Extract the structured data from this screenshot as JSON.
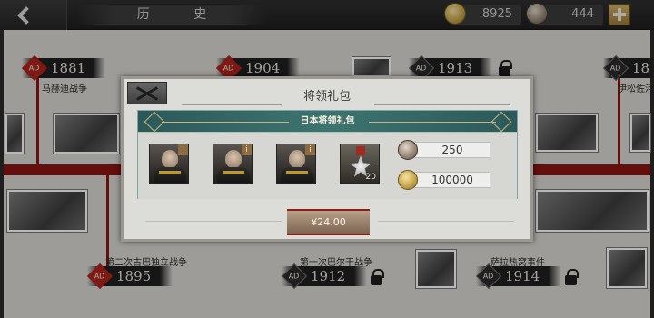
{
  "topbar": {
    "back_icon": "chevron-left-icon",
    "title": "历  史",
    "gold": "8925",
    "silver": "444",
    "plus_icon": "plus-icon"
  },
  "timeline": {
    "events": [
      {
        "ad": "AD",
        "year": "1881",
        "label": "马赫迪战争"
      },
      {
        "ad": "AD",
        "year": "1904",
        "label": ""
      },
      {
        "ad": "AD",
        "year": "1913",
        "label": ""
      },
      {
        "ad": "AD",
        "year": "18",
        "label": "伊松佐河"
      },
      {
        "ad": "AD",
        "year": "1895",
        "label": "第二次古巴独立战争"
      },
      {
        "ad": "AD",
        "year": "1912",
        "label": "第一次巴尔干战争"
      },
      {
        "ad": "AD",
        "year": "1914",
        "label": "萨拉热窝事件"
      }
    ]
  },
  "modal": {
    "title": "将领礼包",
    "pack_name": "日本将领礼包",
    "items": [
      {
        "icon": "general-portrait-icon",
        "badge": "i"
      },
      {
        "icon": "general-portrait-icon",
        "badge": "i"
      },
      {
        "icon": "general-portrait-icon",
        "badge": "i"
      },
      {
        "icon": "medal-icon",
        "count": "20"
      }
    ],
    "silver_amount": "250",
    "gold_amount": "100000",
    "price": "¥24.00"
  },
  "colors": {
    "accent_red": "#8a1512",
    "pack_header": "#3d7470",
    "price_button": "#9a8270"
  }
}
